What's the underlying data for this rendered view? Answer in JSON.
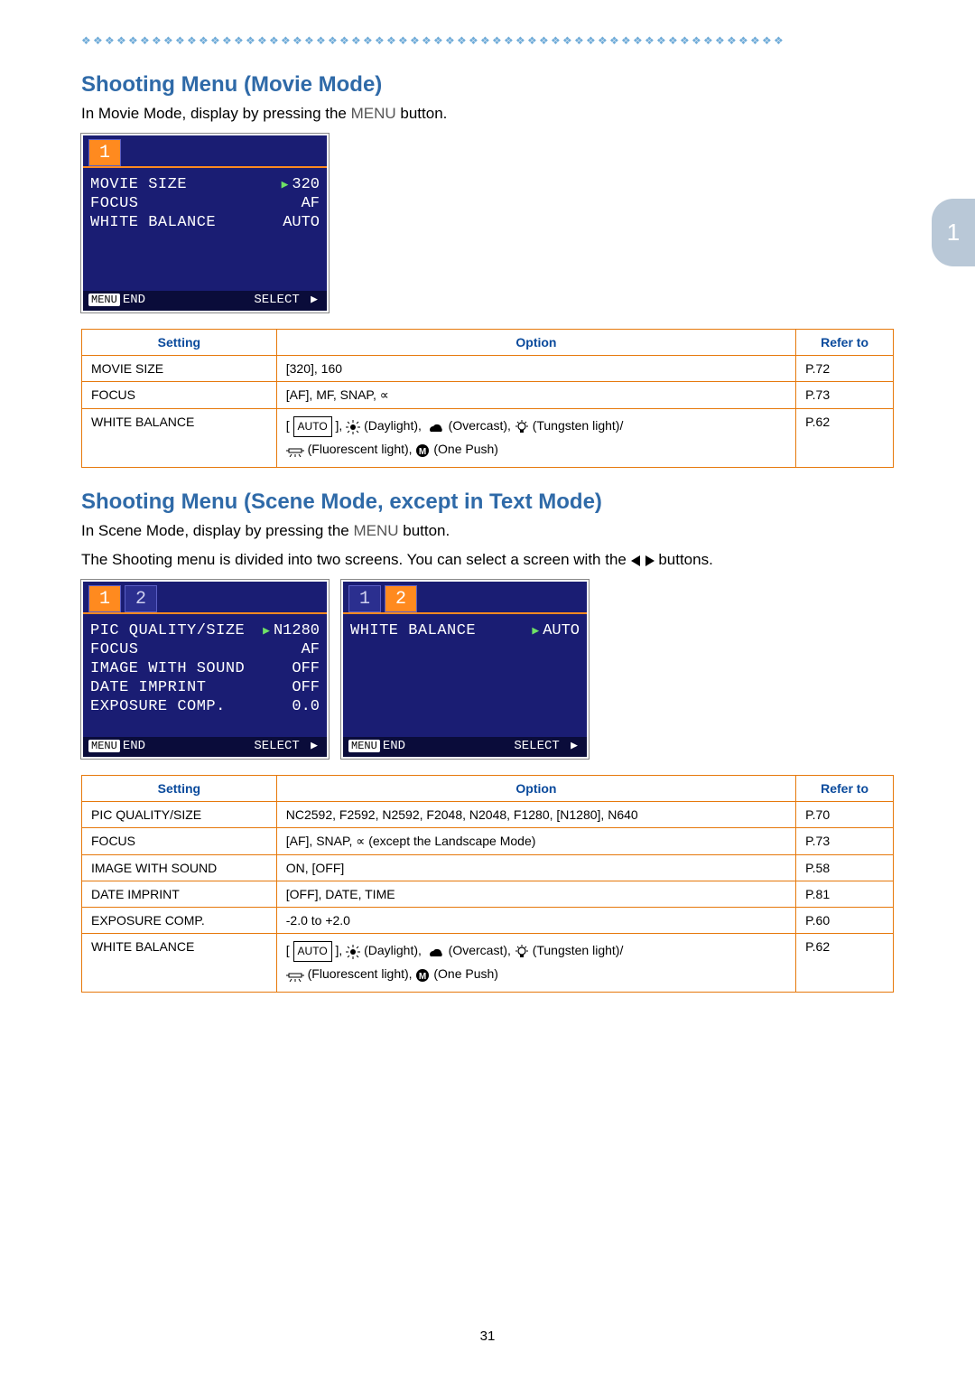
{
  "page_number": "31",
  "side_tab": "1",
  "movie_section": {
    "title": "Shooting Menu (Movie Mode)",
    "intro_prefix": "In Movie Mode, display by pressing the ",
    "intro_menu": "MENU",
    "intro_suffix": " button.",
    "tabs": [
      "1"
    ],
    "active_tab": "1",
    "rows": [
      {
        "label": "MOVIE SIZE",
        "value": "320",
        "selected": true
      },
      {
        "label": "FOCUS",
        "value": "AF",
        "selected": false
      },
      {
        "label": "WHITE BALANCE",
        "value": "AUTO",
        "selected": false
      }
    ],
    "footer_left_badge": "MENU",
    "footer_left": "END",
    "footer_right": "SELECT",
    "table": {
      "headers": {
        "setting": "Setting",
        "option": "Option",
        "refer": "Refer to"
      },
      "rows": [
        {
          "setting": "MOVIE SIZE",
          "option": "[320], 160",
          "refer": "P.72"
        },
        {
          "setting": "FOCUS",
          "option": "[AF], MF, SNAP, ∝",
          "refer": "P.73"
        },
        {
          "setting": "WHITE BALANCE",
          "option_is_wb": true,
          "refer": "P.62"
        }
      ]
    }
  },
  "scene_section": {
    "title": "Shooting Menu (Scene Mode, except in Text Mode)",
    "intro_prefix": "In Scene Mode, display by pressing the ",
    "intro_menu": "MENU",
    "intro_suffix": " button.",
    "sub_intro_prefix": "The Shooting menu is divided into two screens. You can select a screen with the ",
    "sub_intro_suffix": " buttons.",
    "screens": [
      {
        "tabs": [
          "1",
          "2"
        ],
        "active_tab": "1",
        "rows": [
          {
            "label": "PIC QUALITY/SIZE",
            "value": "N1280",
            "selected": true
          },
          {
            "label": "FOCUS",
            "value": "AF",
            "selected": false
          },
          {
            "label": "IMAGE WITH SOUND",
            "value": "OFF",
            "selected": false
          },
          {
            "label": "DATE IMPRINT",
            "value": "OFF",
            "selected": false
          },
          {
            "label": "EXPOSURE COMP.",
            "value": "0.0",
            "selected": false
          }
        ],
        "footer_left_badge": "MENU",
        "footer_left": "END",
        "footer_right": "SELECT"
      },
      {
        "tabs": [
          "1",
          "2"
        ],
        "active_tab": "2",
        "rows": [
          {
            "label": "WHITE BALANCE",
            "value": "AUTO",
            "selected": true
          }
        ],
        "footer_left_badge": "MENU",
        "footer_left": "END",
        "footer_right": "SELECT"
      }
    ],
    "table": {
      "headers": {
        "setting": "Setting",
        "option": "Option",
        "refer": "Refer to"
      },
      "rows": [
        {
          "setting": "PIC QUALITY/SIZE",
          "option": "NC2592, F2592, N2592, F2048, N2048, F1280, [N1280], N640",
          "refer": "P.70"
        },
        {
          "setting": "FOCUS",
          "option": "[AF], SNAP, ∝ (except the Landscape Mode)",
          "refer": "P.73"
        },
        {
          "setting": "IMAGE WITH SOUND",
          "option": "ON, [OFF]",
          "refer": "P.58"
        },
        {
          "setting": "DATE IMPRINT",
          "option": "[OFF], DATE, TIME",
          "refer": "P.81"
        },
        {
          "setting": "EXPOSURE COMP.",
          "option": "-2.0 to +2.0",
          "refer": "P.60"
        },
        {
          "setting": "WHITE BALANCE",
          "option_is_wb": true,
          "refer": "P.62"
        }
      ]
    }
  },
  "wb_option": {
    "auto": "AUTO",
    "daylight": "(Daylight),",
    "overcast": "(Overcast),",
    "tungsten": "(Tungsten light)/",
    "fluorescent": "(Fluorescent light),",
    "onepush": "(One Push)",
    "m_badge": "M"
  }
}
